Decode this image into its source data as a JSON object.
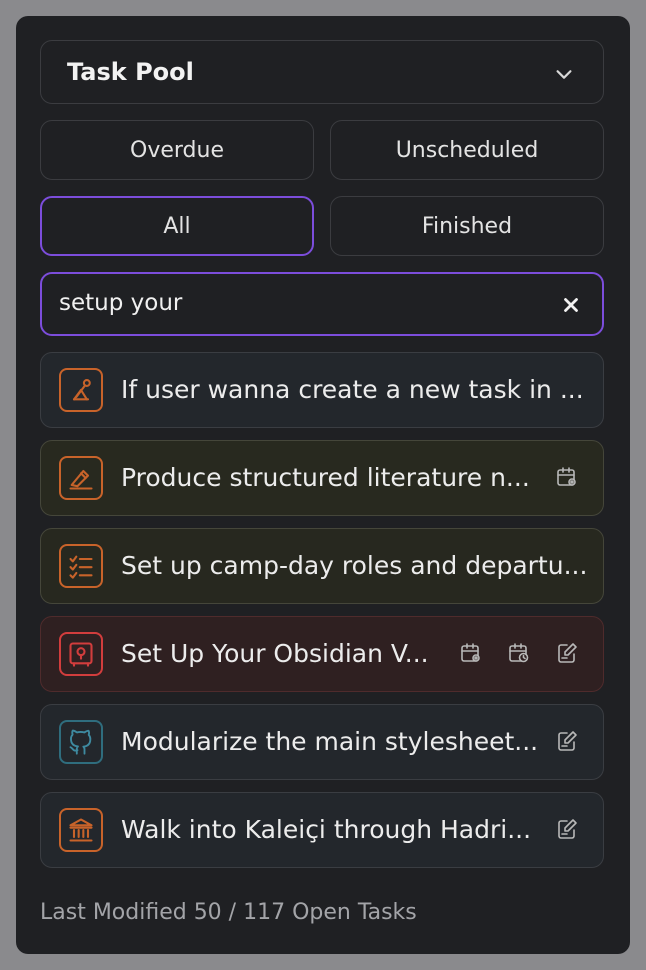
{
  "pool": {
    "title": "Task Pool"
  },
  "filters": {
    "overdue": "Overdue",
    "unscheduled": "Unscheduled",
    "all": "All",
    "finished": "Finished"
  },
  "search": {
    "value": "setup your"
  },
  "tasks": [
    {
      "label": "If user wanna create a new task in ...",
      "icon": "tripod-icon",
      "actions": []
    },
    {
      "label": "Produce structured literature n...",
      "icon": "pen-tool-icon",
      "actions": [
        "calendar-settings-icon"
      ]
    },
    {
      "label": "Set up camp-day roles and departu...",
      "icon": "checklist-icon",
      "actions": []
    },
    {
      "label": "Set Up Your Obsidian V...",
      "icon": "vault-icon",
      "actions": [
        "calendar-settings-icon",
        "calendar-clock-icon",
        "edit-note-icon"
      ]
    },
    {
      "label": "Modularize the main stylesheet...",
      "icon": "github-icon",
      "actions": [
        "edit-note-icon"
      ]
    },
    {
      "label": "Walk into Kaleiçi through Hadri...",
      "icon": "landmark-icon",
      "actions": [
        "edit-note-icon"
      ]
    }
  ],
  "footer": {
    "status": "Last Modified 50 / 117 Open Tasks"
  },
  "colors": {
    "accent": "#7c4ddb",
    "orange_icon": "#c8632a",
    "red_icon": "#d23d3d",
    "teal_icon": "#2f6d7e"
  }
}
